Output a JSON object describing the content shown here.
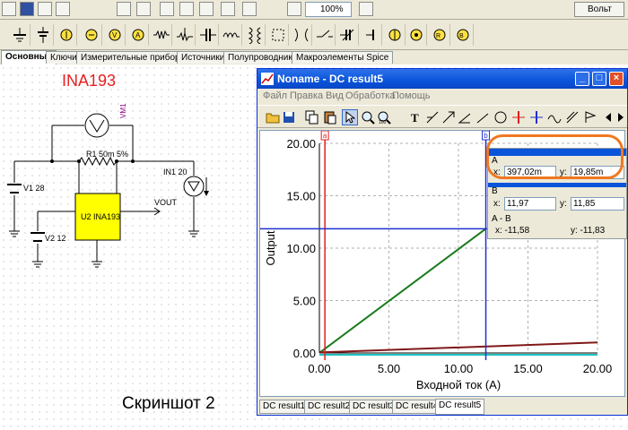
{
  "toolbar": {
    "zoom_value": "100%",
    "wide_button_label": "Вольт"
  },
  "component_tabs": [
    "Основные",
    "Ключи",
    "Измерительные приборы",
    "Источники",
    "Полупроводники",
    "Макроэлементы Spice"
  ],
  "schematic": {
    "component_name": "INA193",
    "vm1_label": "VM1",
    "r1_label": "R1 50m 5%",
    "v1_label": "V1 28",
    "v2_label": "V2 12",
    "u2_label": "U2 INA193",
    "in1_label": "IN1 20",
    "vout_label": "VOUT",
    "caption": "Скриншот 2"
  },
  "window": {
    "title": "Noname - DC result5",
    "menu": [
      "Файл",
      "Правка",
      "Вид",
      "Обработка",
      "Помощь"
    ],
    "result_tabs": [
      "DC result1",
      "DC result2",
      "DC result3",
      "DC result4",
      "DC result5"
    ],
    "active_tab_index": 4
  },
  "cursor_panel": {
    "a_label": "A",
    "b_label": "B",
    "ab_label": "A - B",
    "x_label": "x:",
    "y_label": "y:",
    "a_x": "397,02m",
    "a_y": "19,85m",
    "b_x": "11,97",
    "b_y": "11,85",
    "ab_x": "x: -11,58",
    "ab_y": "y: -11,83"
  },
  "chart_data": {
    "type": "line",
    "xlabel": "Входной ток (A)",
    "ylabel": "Output",
    "xlim": [
      0,
      20
    ],
    "ylim": [
      0,
      20
    ],
    "xticks": [
      "0.00",
      "5.00",
      "10.00",
      "15.00",
      "20.00"
    ],
    "yticks": [
      "0.00",
      "5.00",
      "10.00",
      "15.00",
      "20.00"
    ],
    "grid": true,
    "series": [
      {
        "color": "#1a7a1a",
        "x": [
          0,
          0.4,
          11.97
        ],
        "y": [
          0.02,
          0.4,
          11.85
        ]
      },
      {
        "color": "#801818",
        "x": [
          0,
          20
        ],
        "y": [
          0.05,
          1.0
        ]
      }
    ],
    "cursors": [
      {
        "label": "a",
        "x": 0.397,
        "color": "#e02020"
      },
      {
        "label": "b",
        "x": 11.97,
        "y": 11.85,
        "color": "#2030d0"
      }
    ]
  }
}
